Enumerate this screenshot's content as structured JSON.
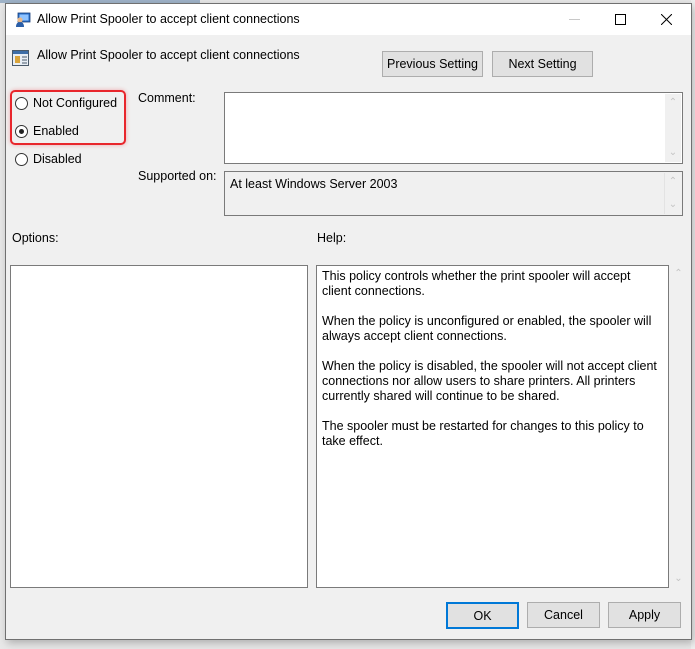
{
  "window": {
    "title": "Allow Print Spooler to accept client connections",
    "controls": {
      "minimize": "minimize-icon",
      "maximize": "maximize-icon",
      "close": "close-icon"
    }
  },
  "header": {
    "policy_name": "Allow Print Spooler to accept client connections",
    "previous_label": "Previous Setting",
    "next_label": "Next Setting"
  },
  "state": {
    "options": [
      {
        "label": "Not Configured",
        "selected": false
      },
      {
        "label": "Enabled",
        "selected": true
      },
      {
        "label": "Disabled",
        "selected": false
      }
    ],
    "highlight_color": "#e8262c"
  },
  "comment": {
    "label": "Comment:",
    "value": ""
  },
  "supported": {
    "label": "Supported on:",
    "value": "At least Windows Server 2003"
  },
  "options_panel": {
    "label": "Options:"
  },
  "help_panel": {
    "label": "Help:",
    "paragraphs": [
      "This policy controls whether the print spooler will accept client connections.",
      "When the policy is unconfigured or enabled, the spooler will always accept client connections.",
      "When the policy is disabled, the spooler will not accept client connections nor allow users to share printers.  All printers currently shared will continue to be shared.",
      "The spooler must be restarted for changes to this policy to take effect."
    ]
  },
  "footer": {
    "ok_label": "OK",
    "cancel_label": "Cancel",
    "apply_label": "Apply",
    "focus_color": "#0078d7"
  }
}
